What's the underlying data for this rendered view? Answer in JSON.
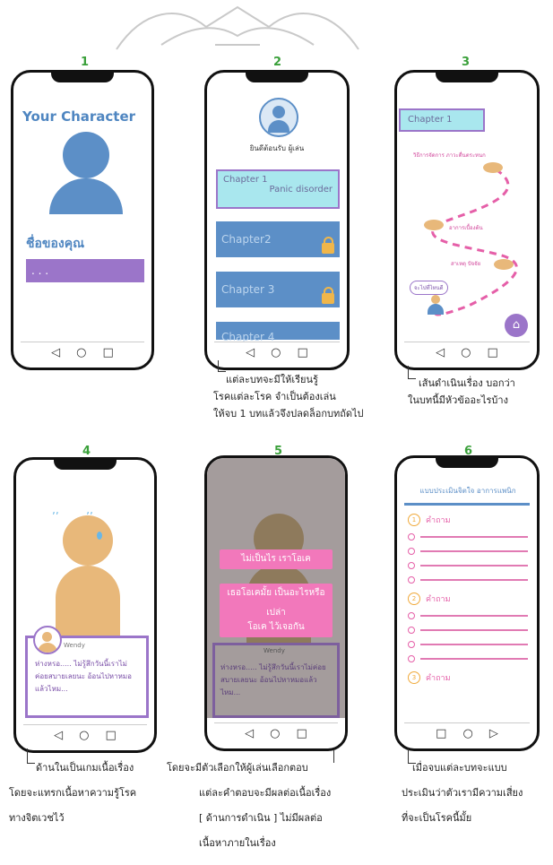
{
  "screens": [
    {
      "number": "1",
      "title": "Your Character",
      "name_label": "ชื่อของคุณ",
      "input_value": ". . ."
    },
    {
      "number": "2",
      "greeting": "ยินดีต้อนรับ ผู้เล่น",
      "chapter1_title": "Chapter 1",
      "chapter1_sub": "Panic disorder",
      "chapters": [
        "Chapter2",
        "Chapter 3",
        "Chapter 4"
      ]
    },
    {
      "number": "3",
      "header": "Chapter 1",
      "nodes": [
        "วิธีการจัดการ ภาวะตื่นตระหนก",
        "อาการเบื้องต้น",
        "สาเหตุ ปัจจัย",
        "จะไปที่ไหนดี"
      ]
    },
    {
      "number": "4",
      "speaker": "Wendy",
      "dialog": "ห่างหรอ..... ไม่รู้สึกวันนี้เราไม่ค่อยสบายเลยนะ อ้อนไปหาหมอแล้วไหม..."
    },
    {
      "number": "5",
      "options": [
        "ไม่เป็นไร เราโอเค",
        "เธอโอเคมั้ย เป็นอะไรหรือเปล่า",
        "โอเค ไว้เจอกัน"
      ],
      "speaker": "Wendy",
      "dialog": "ห่างหรอ..... ไม่รู้สึกวันนี้เราไม่ค่อยสบายเลยนะ อ้อนไปหาหมอแล้วไหม..."
    },
    {
      "number": "6",
      "header": "แบบประเมินจิตใจ อาการแพนิก",
      "questions": [
        {
          "n": "1",
          "label": "คำถาม"
        },
        {
          "n": "2",
          "label": "คำถาม"
        },
        {
          "n": "3",
          "label": "คำถาม"
        }
      ]
    }
  ],
  "annotations": {
    "a2": [
      "แต่ละบทจะมีให้เรียนรู้",
      "โรคแต่ละโรค จำเป็นต้องเล่น",
      "ให้จบ 1 บทแล้วจึงปลดล็อกบทถัดไป"
    ],
    "a3": [
      "เส้นดำเนินเรื่อง บอกว่า",
      "ในบทนี้มีหัวข้ออะไรบ้าง"
    ],
    "a4": [
      "ด้านในเป็นเกมเนื้อเรื่อง",
      "โดยจะแทรกเนื้อหาความรู้โรค",
      "ทางจิตเวชไว้"
    ],
    "a5": [
      "โดยจะมีตัวเลือกให้ผู้เล่นเลือกตอบ",
      "แต่ละคำตอบจะมีผลต่อเนื้อเรื่อง",
      "[ ด้านการดำเนิน ] ไม่มีผลต่อ",
      "เนื้อหาภายในเรื่อง"
    ],
    "a6": [
      "เมื่อจบแต่ละบทจะแบบ",
      "ประเมินว่าตัวเรามีความเสี่ยง",
      "ที่จะเป็นโรคนี้มั้ย"
    ]
  },
  "nav_icons": [
    "back-triangle",
    "home-circle",
    "recent-square"
  ],
  "colors": {
    "blue": "#5c8fc7",
    "purple": "#9b75c9",
    "pink": "#f278bb",
    "orange": "#e8b87a",
    "cyan": "#a9e7ee"
  }
}
